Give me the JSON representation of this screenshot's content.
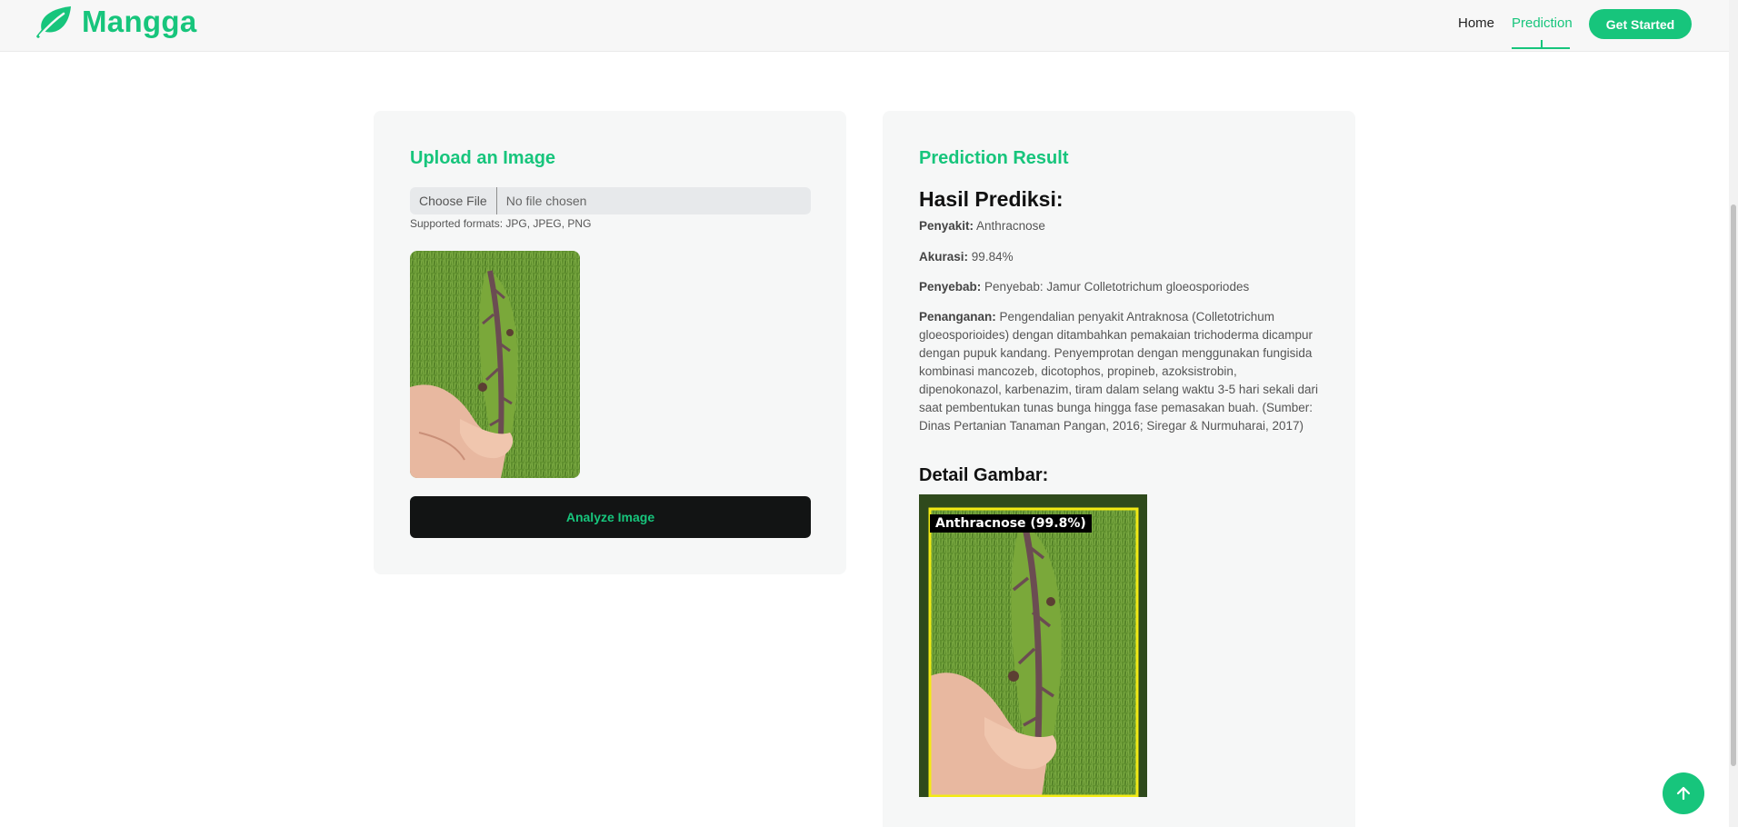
{
  "brand": {
    "name": "Mangga",
    "color": "#17c57c"
  },
  "nav": {
    "home": "Home",
    "prediction": "Prediction",
    "cta": "Get Started"
  },
  "upload": {
    "title": "Upload an Image",
    "file_button": "Choose File",
    "file_status": "No file chosen",
    "formats": "Supported formats: JPG, JPEG, PNG",
    "analyze": "Analyze Image"
  },
  "result": {
    "title": "Prediction Result",
    "heading": "Hasil Prediksi:",
    "disease_label": "Penyakit:",
    "disease_value": "Anthracnose",
    "accuracy_label": "Akurasi:",
    "accuracy_value": "99.84%",
    "cause_label": "Penyebab:",
    "cause_value": "Penyebab: Jamur Colletotrichum gloeosporiodes",
    "treatment_label": "Penanganan:",
    "treatment_value": "Pengendalian penyakit Antraknosa (Colletotrichum gloeosporioides) dengan ditambahkan pemakaian trichoderma dicampur dengan pupuk kandang. Penyemprotan dengan menggunakan fungisida kombinasi mancozeb, dicotophos, propineb, azoksistrobin, dipenokonazol, karbenazim, tiram dalam selang waktu 3-5 hari sekali dari saat pembentukan tunas bunga hingga fase pemasakan buah. (Sumber: Dinas Pertanian Tanaman Pangan, 2016; Siregar & Nurmuharai, 2017)",
    "detail_heading": "Detail Gambar:",
    "detection_label": "Anthracnose (99.8%)"
  },
  "icons": {
    "logo": "leaf-icon",
    "scroll_top": "arrow-up-icon"
  }
}
